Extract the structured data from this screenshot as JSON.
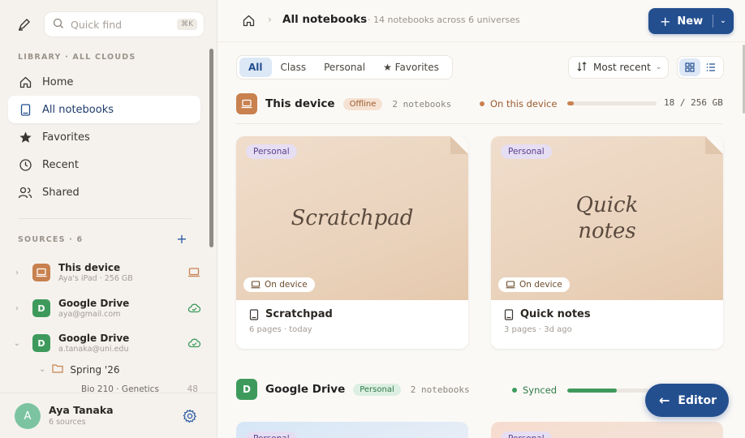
{
  "sidebar": {
    "quickfind_placeholder": "Quick find",
    "quickfind_shortcut": "⌘K",
    "library_label": "LIBRARY · ALL CLOUDS",
    "nav": [
      {
        "label": "Home",
        "icon": "home-icon"
      },
      {
        "label": "All notebooks",
        "icon": "notebook-icon"
      },
      {
        "label": "Favorites",
        "icon": "star-icon"
      },
      {
        "label": "Recent",
        "icon": "clock-icon"
      },
      {
        "label": "Shared",
        "icon": "people-icon"
      }
    ],
    "sources_label": "SOURCES · 6",
    "sources": [
      {
        "name": "This device",
        "sub": "Aya's iPad · 256 GB",
        "badge": "",
        "color": "#c8814f",
        "status_icon": "laptop-icon"
      },
      {
        "name": "Google Drive",
        "sub": "aya@gmail.com",
        "badge": "D",
        "color": "#3e9a5c",
        "status_icon": "cloud-check-icon"
      },
      {
        "name": "Google Drive",
        "sub": "a.tanaka@uni.edu",
        "badge": "D",
        "color": "#3e9a5c",
        "status_icon": "cloud-check-icon"
      }
    ],
    "folder": {
      "name": "Spring '26"
    },
    "subitem": {
      "name": "Bio 210 · Genetics",
      "count": "48"
    },
    "user": {
      "initial": "A",
      "name": "Aya Tanaka",
      "sub": "6 sources"
    }
  },
  "header": {
    "title": "All notebooks",
    "subtitle": "· 14 notebooks across 6 universes",
    "new_label": "New"
  },
  "filters": {
    "tabs": [
      "All",
      "Class",
      "Personal",
      "★ Favorites"
    ],
    "active": 0,
    "sort_label": "Most recent"
  },
  "groups": [
    {
      "name": "This device",
      "pill": "Offline",
      "count": "2 notebooks",
      "status": "On this device",
      "status_color": "#c8814f",
      "storage": "18 / 256 GB",
      "usage_fraction": 0.07,
      "bar_color": "#c8814f"
    },
    {
      "badge": "D",
      "name": "Google Drive",
      "pill": "Personal",
      "count": "2 notebooks",
      "status": "Synced",
      "status_color": "#3e9a5c",
      "usage_fraction": 0.55,
      "bar_color": "#3e9a5c"
    }
  ],
  "cards": [
    {
      "tag": "Personal",
      "cover_title": "Scratchpad",
      "location": "On device",
      "title": "Scratchpad",
      "meta": "6 pages · today"
    },
    {
      "tag": "Personal",
      "cover_title": "Quick\nnotes",
      "location": "On device",
      "title": "Quick notes",
      "meta": "3 pages · 3d ago"
    }
  ],
  "peek_cards": [
    {
      "tag": "Personal"
    },
    {
      "tag": "Personal"
    }
  ],
  "fab": {
    "label": "Editor"
  },
  "colors": {
    "accent": "#244f8f",
    "device": "#c8814f",
    "drive": "#3e9a5c"
  }
}
